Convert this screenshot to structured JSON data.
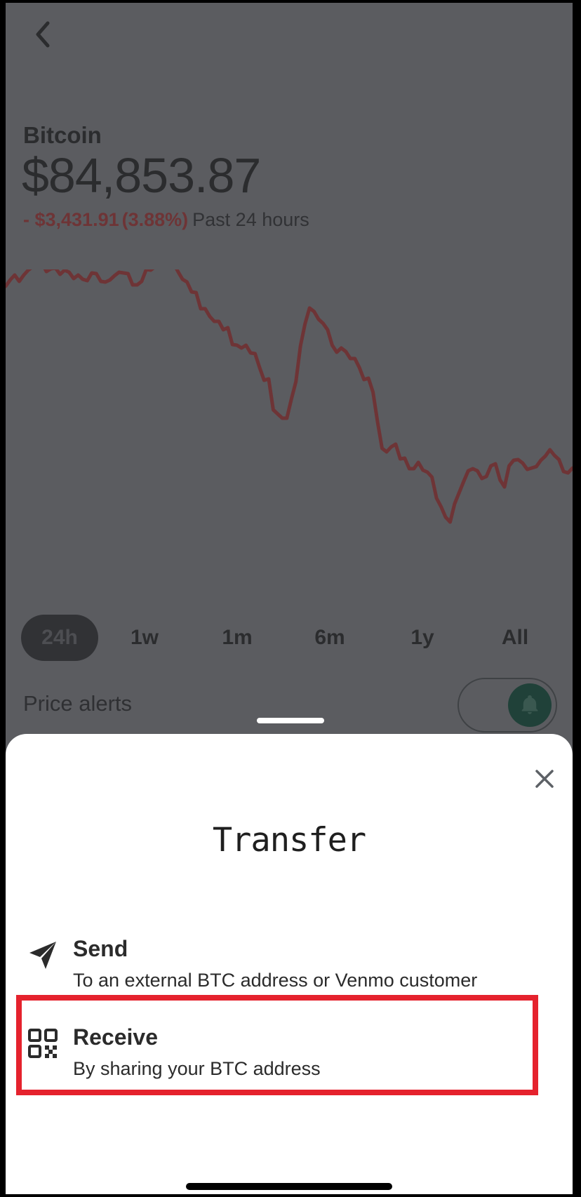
{
  "header": {
    "back_icon": "chevron-left-icon"
  },
  "asset": {
    "name": "Bitcoin",
    "price": "$84,853.87",
    "change_amount": "- $3,431.91",
    "change_percent": "(3.88%)",
    "change_period": "Past 24 hours"
  },
  "chart_data": {
    "type": "line",
    "period": "24h",
    "series": [
      {
        "values": [
          404,
          395,
          388,
          397,
          388,
          381,
          376,
          370,
          371,
          383,
          379,
          378,
          387,
          381,
          384,
          393,
          388,
          394,
          396,
          385,
          386,
          397,
          398,
          395,
          389,
          384,
          385,
          386,
          402,
          402,
          397,
          380,
          381,
          376,
          373,
          371,
          374,
          371,
          383,
          394,
          398,
          412,
          413,
          436,
          436,
          447,
          454,
          454,
          466,
          463,
          487,
          488,
          492,
          488,
          499,
          500,
          520,
          538,
          536,
          580,
          586,
          592,
          592,
          565,
          540,
          489,
          458,
          435,
          440,
          451,
          457,
          466,
          488,
          498,
          492,
          497,
          507,
          507,
          520,
          537,
          535,
          555,
          597,
          635,
          640,
          633,
          629,
          650,
          649,
          664,
          664,
          655,
          666,
          669,
          676,
          706,
          718,
          733,
          740,
          714,
          698,
          682,
          667,
          664,
          667,
          678,
          675,
          660,
          657,
          680,
          690,
          660,
          652,
          651,
          656,
          665,
          663,
          661,
          652,
          646,
          637,
          645,
          651,
          668,
          670,
          663
        ],
        "color": "#6e3436"
      }
    ],
    "y_direction": "price (unlabeled axis)"
  },
  "ranges": [
    {
      "label": "24h",
      "active": true
    },
    {
      "label": "1w",
      "active": false
    },
    {
      "label": "1m",
      "active": false
    },
    {
      "label": "6m",
      "active": false
    },
    {
      "label": "1y",
      "active": false
    },
    {
      "label": "All",
      "active": false
    }
  ],
  "alerts": {
    "label": "Price alerts",
    "icon": "bell-icon"
  },
  "sheet": {
    "title": "Transfer",
    "close_icon": "close-icon",
    "options": [
      {
        "title": "Send",
        "subtitle": "To an external BTC address or Venmo customer",
        "icon": "paper-plane-icon"
      },
      {
        "title": "Receive",
        "subtitle": "By sharing your BTC address",
        "icon": "qr-code-icon",
        "highlighted": true
      }
    ]
  },
  "colors": {
    "overlay_bg": "#5b5c60",
    "negative": "#6e3436",
    "highlight": "#e5222d",
    "sheet_bg": "#ffffff",
    "toggle_knob": "#204139"
  }
}
